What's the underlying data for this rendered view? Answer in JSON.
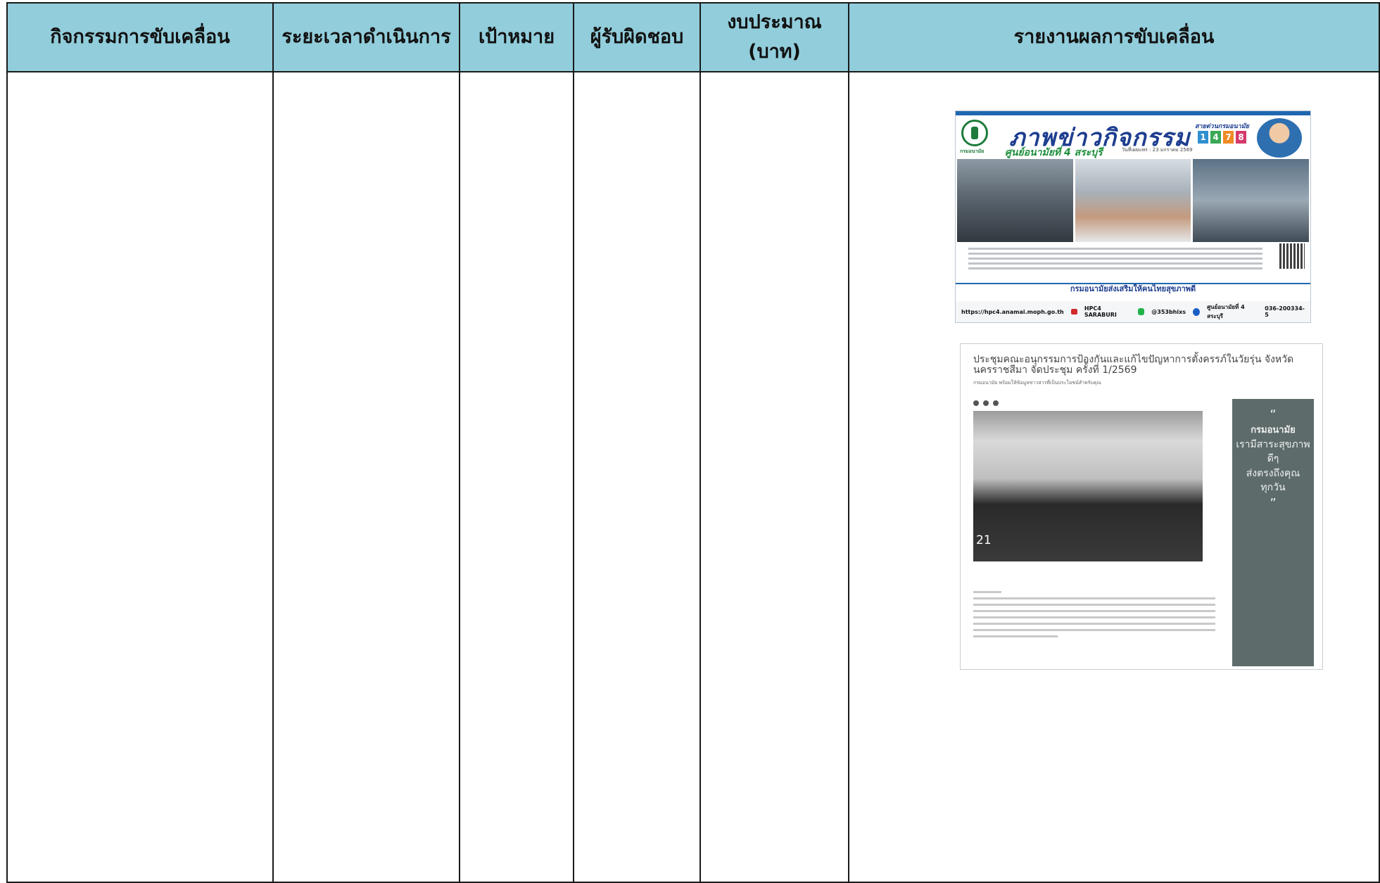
{
  "table": {
    "headers": {
      "activity": "กิจกรรมการขับเคลื่อน",
      "duration": "ระยะเวลาดำเนินการ",
      "target": "เป้าหมาย",
      "responsible": "ผู้รับผิดชอบ",
      "budget_line1": "งบประมาณ",
      "budget_line2": "(บาท)",
      "report": "รายงานผลการขับเคลื่อน"
    },
    "header_bg": "#92cddb"
  },
  "poster": {
    "title": "ภาพข่าวกิจกรรม",
    "subtitle": "ศูนย์อนามัยที่ 4 สระบุรี",
    "logo_caption": "กรมอนามัย",
    "date": "วันที่เผยแพร่ : 23 มกราคม 2569",
    "hotline_label": "สายด่วนกรมอนามัย",
    "hotline_digits": [
      "1",
      "4",
      "7",
      "8"
    ],
    "slogan": "กรมอนามัยส่งเสริมให้คนไทยสุขภาพดี",
    "website": "https://hpc4.anamai.moph.go.th",
    "youtube": "HPC4 SARABURI",
    "line": "@353bhixs",
    "facebook": "ศูนย์อนามัยที่ 4 สระบุรี",
    "phone": "036-200334-5"
  },
  "article": {
    "title": "ประชุมคณะอนุกรรมการป้องกันและแก้ไขปัญหาการตั้งครรภ์ในวัยรุ่น จังหวัดนครราชสีมา จัดประชุม ครั้งที่ 1/2569",
    "byline": "กรมอนามัย พร้อมให้ข้อมูลข่าวสารที่เป็นประโยชน์สำหรับคุณ",
    "date_badge": "21",
    "quote_brand": "กรมอนามัย",
    "quote_line1": "เรามีสาระสุขภาพดีๆ",
    "quote_line2": "ส่งตรงถึงคุณ",
    "quote_line3": "ทุกวัน"
  }
}
